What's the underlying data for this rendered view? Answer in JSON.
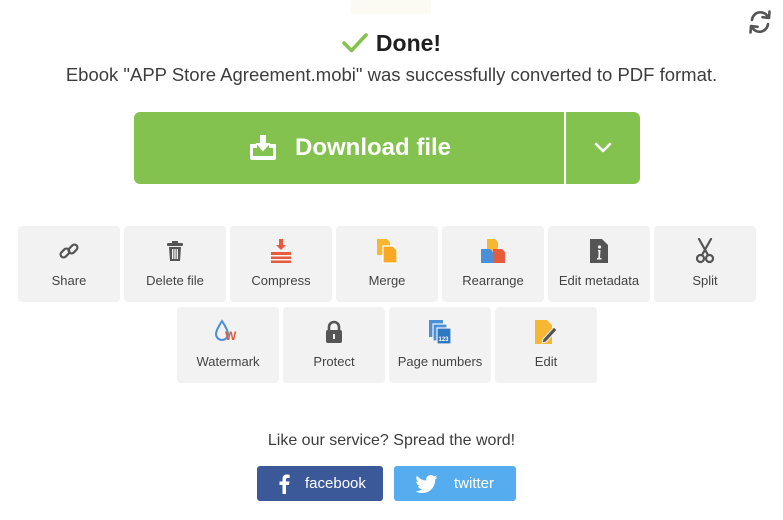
{
  "status": {
    "done_label": "Done!",
    "message": "Ebook \"APP Store Agreement.mobi\" was successfully converted to PDF format."
  },
  "download": {
    "label": "Download file"
  },
  "tools_row1": [
    {
      "label": "Share",
      "icon": "link-icon"
    },
    {
      "label": "Delete file",
      "icon": "trash-icon"
    },
    {
      "label": "Compress",
      "icon": "compress-icon"
    },
    {
      "label": "Merge",
      "icon": "merge-icon"
    },
    {
      "label": "Rearrange",
      "icon": "rearrange-icon"
    },
    {
      "label": "Edit metadata",
      "icon": "info-document-icon"
    },
    {
      "label": "Split",
      "icon": "scissors-icon"
    }
  ],
  "tools_row2": [
    {
      "label": "Watermark",
      "icon": "watermark-icon"
    },
    {
      "label": "Protect",
      "icon": "lock-icon"
    },
    {
      "label": "Page numbers",
      "icon": "page-numbers-icon"
    },
    {
      "label": "Edit",
      "icon": "pencil-document-icon"
    }
  ],
  "share": {
    "prompt": "Like our service? Spread the word!",
    "facebook_label": "facebook",
    "twitter_label": "twitter"
  },
  "colors": {
    "accent_green": "#84c250",
    "tile_bg": "#f2f2f2",
    "facebook": "#3b5998",
    "twitter": "#55acee"
  }
}
